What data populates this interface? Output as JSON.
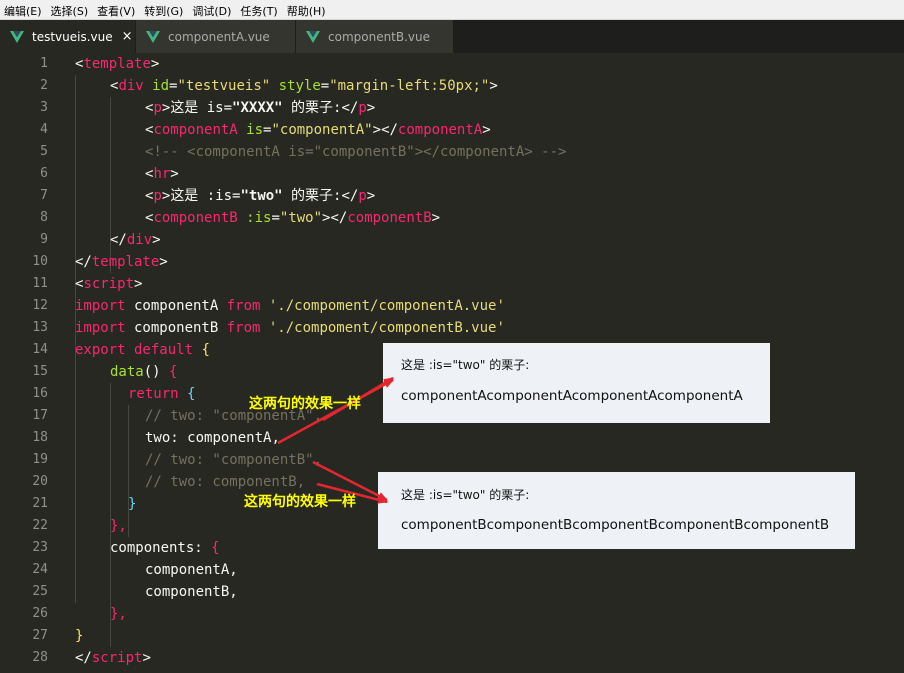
{
  "menu": [
    "编辑(E)",
    "选择(S)",
    "查看(V)",
    "转到(G)",
    "调试(D)",
    "任务(T)",
    "帮助(H)"
  ],
  "tabs": [
    {
      "label": "testvueis.vue",
      "active": true,
      "close": "×"
    },
    {
      "label": "componentA.vue",
      "active": false
    },
    {
      "label": "componentB.vue",
      "active": false
    }
  ],
  "colors": {
    "editor_bg": "#272822",
    "tag": "#f92672",
    "attr": "#a6e22e",
    "string": "#e6db74",
    "comment": "#75715e",
    "annotation": "#ffff00",
    "arrow": "#e3262f"
  },
  "code": {
    "line_numbers": [
      "1",
      "2",
      "3",
      "4",
      "5",
      "6",
      "7",
      "8",
      "9",
      "10",
      "11",
      "12",
      "13",
      "14",
      "15",
      "16",
      "17",
      "18",
      "19",
      "20",
      "21",
      "22",
      "23",
      "24",
      "25",
      "26",
      "27",
      "28"
    ],
    "l1": {
      "lt": "<",
      "tag": "template",
      "gt": ">"
    },
    "l2": {
      "lt": "<",
      "tag": "div",
      "a1": " id",
      "eq1": "=",
      "v1": "\"testvueis\"",
      "a2": " style",
      "eq2": "=",
      "v2": "\"margin-left:50px;\"",
      "gt": ">"
    },
    "l3": {
      "lt": "<",
      "tag": "p",
      "gt": ">",
      "text": "这是 is=",
      "bold": "\"XXXX\"",
      "text2": " 的栗子:",
      "lt2": "</",
      "tag2": "p",
      "gt2": ">"
    },
    "l4": {
      "lt": "<",
      "tag": "componentA",
      "a1": " is",
      "eq1": "=",
      "v1": "\"componentA\"",
      "gt": ">",
      "lt2": "</",
      "tag2": "componentA",
      "gt2": ">"
    },
    "l5": {
      "comment": "<!-- <componentA is=\"componentB\"></componentA> -->"
    },
    "l6": {
      "lt": "<",
      "tag": "hr",
      "gt": ">"
    },
    "l7": {
      "lt": "<",
      "tag": "p",
      "gt": ">",
      "text": "这是 :is=",
      "bold": "\"two\"",
      "text2": " 的栗子:",
      "lt2": "</",
      "tag2": "p",
      "gt2": ">"
    },
    "l8": {
      "lt": "<",
      "tag": "componentB",
      "a1": " :is",
      "eq1": "=",
      "v1": "\"two\"",
      "gt": ">",
      "lt2": "</",
      "tag2": "componentB",
      "gt2": ">"
    },
    "l9": {
      "lt": "</",
      "tag": "div",
      "gt": ">"
    },
    "l10": {
      "lt": "</",
      "tag": "template",
      "gt": ">"
    },
    "l11": {
      "lt": "<",
      "tag": "script",
      "gt": ">"
    },
    "l12": {
      "kw": "import",
      "name": " componentA ",
      "kw2": "from",
      "str": " './compoment/componentA.vue'"
    },
    "l13": {
      "kw": "import",
      "name": " componentB ",
      "kw2": "from",
      "str": " './compoment/componentB.vue'"
    },
    "l14": {
      "kw": "export",
      "kw2": " default",
      "brace": " {"
    },
    "l15": {
      "fn": "data",
      "paren": "()",
      "brace": " {"
    },
    "l16": {
      "kw": "return",
      "brace": " {"
    },
    "l17": {
      "comment": "// two: \"componentA\","
    },
    "l18": {
      "name": "two",
      "colon": ": ",
      "val": "componentA",
      "comma": ","
    },
    "l19": {
      "comment": "// two: \"componentB\","
    },
    "l20": {
      "comment": "// two: componentB,"
    },
    "l21": {
      "brace": "}"
    },
    "l22": {
      "brace": "},"
    },
    "l23": {
      "name": "components",
      "colon": ": ",
      "brace": "{"
    },
    "l24": {
      "text": "componentA,"
    },
    "l25": {
      "text": "componentB,"
    },
    "l26": {
      "brace": "},"
    },
    "l27": {
      "brace": "}"
    },
    "l28": {
      "lt": "</",
      "tag": "script",
      "gt": ">"
    }
  },
  "popup_a": {
    "title": "这是 :is=\"two\" 的栗子:",
    "body": "componentAcomponentAcomponentAcomponentA"
  },
  "popup_b": {
    "title": "这是 :is=\"two\" 的栗子:",
    "body": "componentBcomponentBcomponentBcomponentBcomponentB"
  },
  "annotations": {
    "note_a": "这两句的效果一样",
    "note_b": "这两句的效果一样"
  }
}
